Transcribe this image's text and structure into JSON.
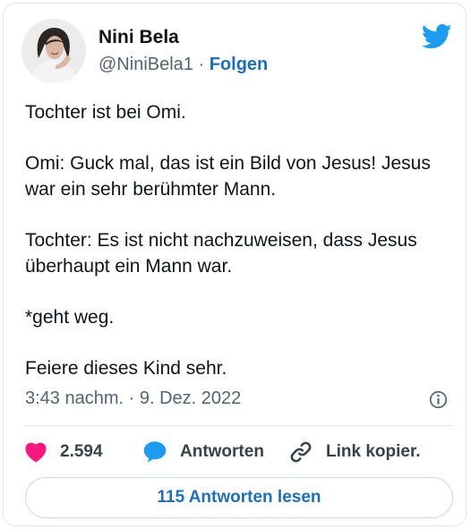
{
  "author": {
    "name": "Nini Bela",
    "handle": "@NiniBela1",
    "separator": "·",
    "follow_label": "Folgen"
  },
  "brand_icon": "twitter-bird-icon",
  "tweet": {
    "paragraphs": [
      "Tochter ist bei Omi.",
      "Omi: Guck mal, das ist ein Bild von Jesus! Jesus war ein sehr berühmter Mann.",
      "Tochter: Es ist nicht nachzuweisen, dass Jesus überhaupt ein Mann war.",
      "*geht weg.",
      "Feiere dieses Kind sehr."
    ],
    "time": "3:43 nachm.",
    "date_separator": "·",
    "date": "9. Dez. 2022"
  },
  "actions": {
    "like_count": "2.594",
    "reply_label": "Antworten",
    "copy_link_label": "Link kopier."
  },
  "read_replies_label": "115 Antworten lesen",
  "colors": {
    "like": "#f91880",
    "reply": "#1d9bf0",
    "link": "#1d6fb8",
    "twitter_blue": "#1d9bf0",
    "muted_text": "#536471"
  }
}
